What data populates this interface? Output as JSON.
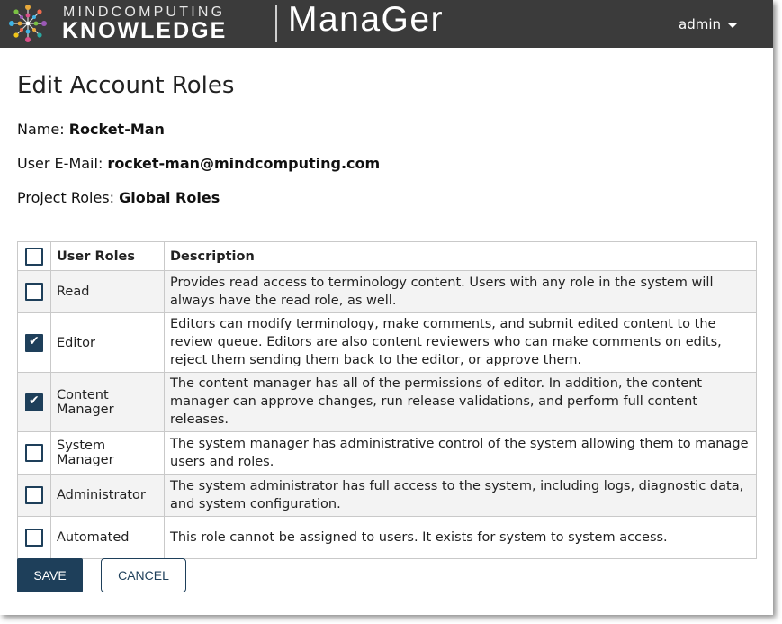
{
  "header": {
    "brand_top": "MINDCOMPUTING",
    "brand_bottom": "KNOWLEDGE",
    "product": "ManaGer",
    "user": "admin"
  },
  "page": {
    "title": "Edit Account Roles",
    "name_label": "Name: ",
    "name_value": "Rocket-Man",
    "email_label": "User E-Mail: ",
    "email_value": "rocket-man@mindcomputing.com",
    "project_label": "Project Roles: ",
    "project_value": "Global Roles"
  },
  "table": {
    "header_all_checked": false,
    "col_roles": "User Roles",
    "col_desc": "Description",
    "rows": [
      {
        "role": "Read",
        "checked": false,
        "desc": "Provides read access to terminology content. Users with any role in the system will always have the read role, as well."
      },
      {
        "role": "Editor",
        "checked": true,
        "desc": "Editors can modify terminology, make comments, and submit edited content to the review queue. Editors are also content reviewers who can make comments on edits, reject them sending them back to the editor, or approve them."
      },
      {
        "role": "Content Manager",
        "checked": true,
        "desc": "The content manager has all of the permissions of editor. In addition, the content manager can approve changes, run release validations, and perform full content releases."
      },
      {
        "role": "System Manager",
        "checked": false,
        "desc": "The system manager has administrative control of the system allowing them to manage users and roles."
      },
      {
        "role": "Administrator",
        "checked": false,
        "desc": "The system administrator has full access to the system, including logs, diagnostic data, and system configuration."
      },
      {
        "role": "Automated",
        "checked": false,
        "desc": "This role cannot be assigned to users. It exists for system to system access."
      }
    ]
  },
  "buttons": {
    "save": "SAVE",
    "cancel": "CANCEL"
  },
  "colors": {
    "header_bg": "#3b3b3b",
    "accent": "#1e3f5a"
  }
}
